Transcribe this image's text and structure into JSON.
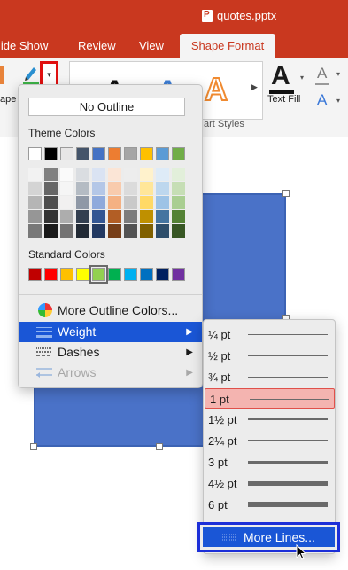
{
  "window": {
    "file_name": "quotes.pptx"
  },
  "tabs": [
    {
      "label": "lide Show"
    },
    {
      "label": "Review"
    },
    {
      "label": "View"
    },
    {
      "label": "Shape Format"
    }
  ],
  "ribbon": {
    "left_label": "ape",
    "gallery_letters": [
      "A",
      "A",
      "A"
    ],
    "group_label": "art Styles",
    "text_fill": {
      "letter": "A",
      "label": "Text Fill"
    },
    "text_outline_letter": "A",
    "text_effects_letter": "A"
  },
  "outline_menu": {
    "no_outline": "No Outline",
    "theme_colors_heading": "Theme Colors",
    "theme_colors": [
      "#ffffff",
      "#000000",
      "#e7e6e6",
      "#44546a",
      "#4472c4",
      "#ed7d31",
      "#a5a5a5",
      "#ffc000",
      "#5b9bd5",
      "#70ad47"
    ],
    "standard_colors_heading": "Standard Colors",
    "standard_colors": [
      "#c00000",
      "#ff0000",
      "#ffc000",
      "#ffff00",
      "#92d050",
      "#00b050",
      "#00b0f0",
      "#0070c0",
      "#002060",
      "#7030a0"
    ],
    "items": [
      {
        "label": "More Outline Colors..."
      },
      {
        "label": "Weight"
      },
      {
        "label": "Dashes"
      },
      {
        "label": "Arrows"
      }
    ]
  },
  "weight_menu": {
    "items": [
      {
        "label": "¼ pt",
        "weight": 0.25
      },
      {
        "label": "½ pt",
        "weight": 0.5
      },
      {
        "label": "¾ pt",
        "weight": 0.75
      },
      {
        "label": "1 pt",
        "weight": 1
      },
      {
        "label": "1½ pt",
        "weight": 1.5
      },
      {
        "label": "2¼ pt",
        "weight": 2.25
      },
      {
        "label": "3 pt",
        "weight": 3
      },
      {
        "label": "4½ pt",
        "weight": 4.5
      },
      {
        "label": "6 pt",
        "weight": 6
      }
    ],
    "selected": "1 pt",
    "more_lines": "More Lines..."
  },
  "colors": {
    "ribbon_accent": "#c9381f",
    "menu_highlight": "#1a56d6",
    "shape_fill": "#4a72c8"
  }
}
